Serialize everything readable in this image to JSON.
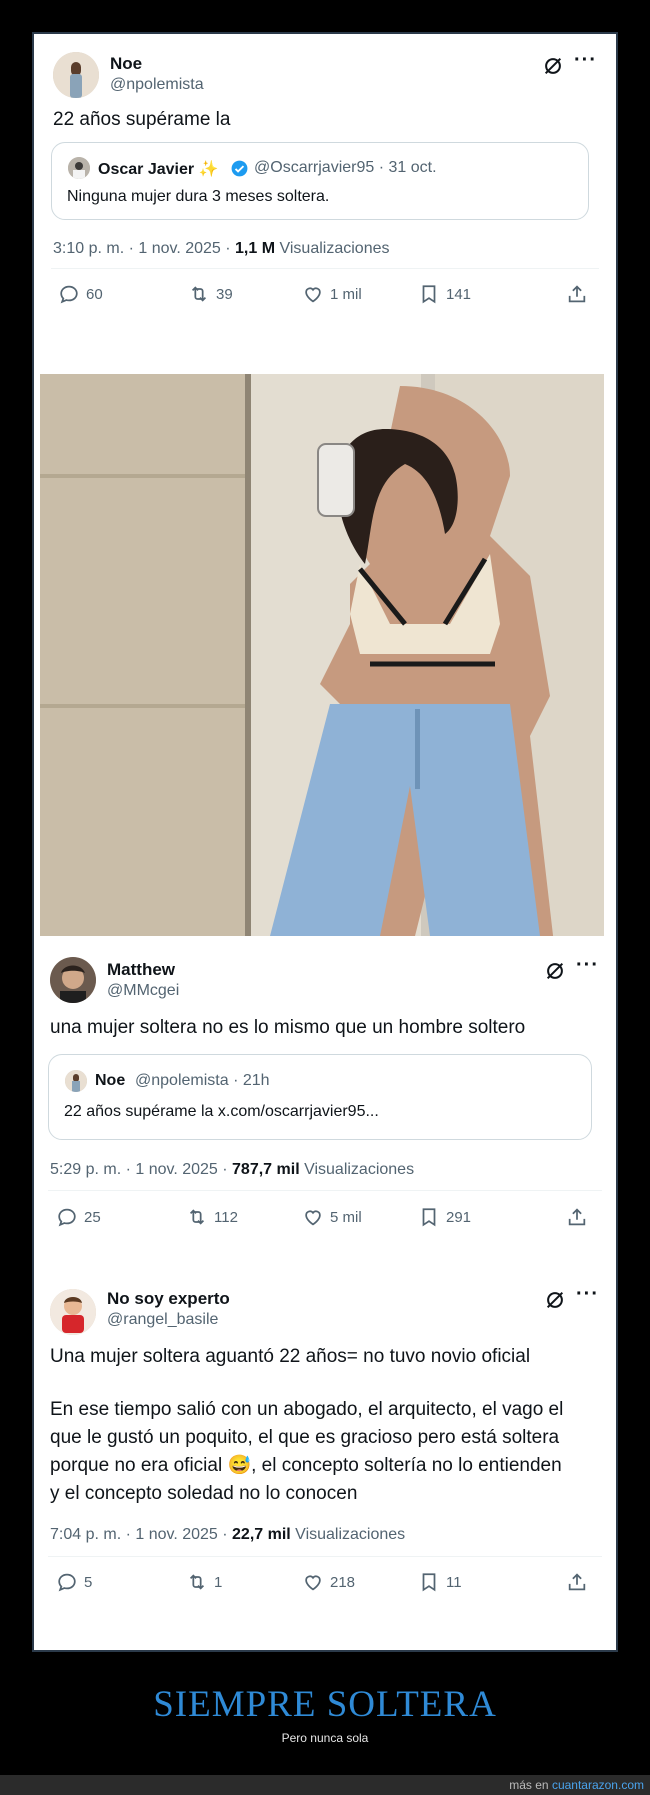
{
  "tweets": [
    {
      "name": "Noe",
      "handle": "@npolemista",
      "text": "22 años supérame la",
      "quote": {
        "name": "Oscar Javier ✨",
        "rest": "@Oscarrjavier95 · 31 oct.",
        "text": "Ninguna mujer dura 3 meses soltera."
      },
      "meta_time": "3:10 p. m. · 1 nov. 2025 · ",
      "meta_views": "1,1 M",
      "meta_suffix": " Visualizaciones",
      "replies": "60",
      "retweets": "39",
      "likes": "1 mil",
      "bookmarks": "141"
    },
    {
      "name": "Matthew",
      "handle": "@MMcgei",
      "text": "una mujer soltera no es lo mismo que un hombre soltero",
      "quote": {
        "name": "Noe",
        "rest": "@npolemista · 21h",
        "text": "22 años supérame la x.com/oscarrjavier95..."
      },
      "meta_time": "5:29 p. m. · 1 nov. 2025 · ",
      "meta_views": "787,7 mil",
      "meta_suffix": " Visualizaciones",
      "replies": "25",
      "retweets": "112",
      "likes": "5 mil",
      "bookmarks": "291"
    },
    {
      "name": "No soy experto",
      "handle": "@rangel_basile",
      "text_line1": "Una mujer soltera aguantó 22 años= no tuvo novio oficial",
      "text_line2": "En ese tiempo salió con un abogado, el arquitecto, el vago el",
      "text_line3": "que le gustó un poquito, el que es gracioso pero está soltera",
      "text_line4": "porque no era oficial 😅, el concepto soltería no lo entienden",
      "text_line5": "y el concepto soledad no lo conocen",
      "meta_time": "7:04 p. m. · 1 nov. 2025 · ",
      "meta_views": "22,7 mil",
      "meta_suffix": " Visualizaciones",
      "replies": "5",
      "retweets": "1",
      "likes": "218",
      "bookmarks": "11"
    }
  ],
  "caption": {
    "title": "SIEMPRE SOLTERA",
    "subtitle": "Pero nunca sola"
  },
  "footer": {
    "prefix": "más en ",
    "site": "cuantarazon.com"
  },
  "colors": {
    "accent": "#2f8ad6",
    "verified": "#1d9bf0"
  }
}
